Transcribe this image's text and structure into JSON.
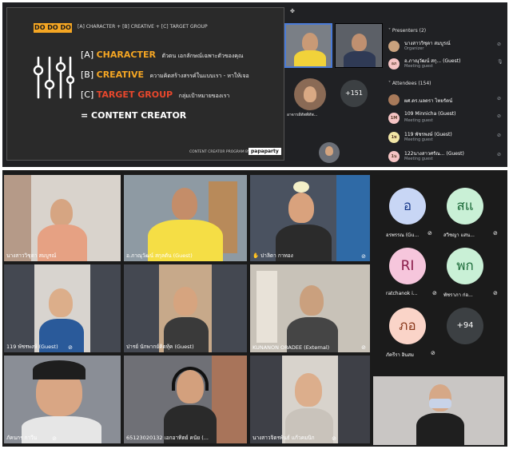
{
  "slide": {
    "logo": "DO DO DO",
    "header": "[A] CHARACTER + [B] CREATIVE + [C] TARGET GROUP",
    "line_a_key": "[A]",
    "line_a_word": "CHARACTER",
    "line_a_thai": "ตัวตน เอกลักษณ์เฉพาะตัวของคุณ",
    "line_b_key": "[B]",
    "line_b_word": "CREATIVE",
    "line_b_thai": "ความคิดสร้างสรรค์ในแบบเรา - หาให้เจอ",
    "line_c_key": "[C]",
    "line_c_word": "TARGET GROUP",
    "line_c_thai": "กลุ่มเป้าหมายของเรา",
    "formula": "= CONTENT CREATOR",
    "footer": "CONTENT CREATOR PROGRAM BY",
    "footer_logo": "papaparty"
  },
  "top_tiles": {
    "tile4_label": "อาจารย์ทัพพ์ทัพ...",
    "more_count": "+151"
  },
  "panel": {
    "presenters_title": "Presenters (2)",
    "presenters": [
      {
        "name": "นางสาววิชุดา สมบูรณ์",
        "sub": "Organizer",
        "initials": "",
        "color": "#c9a27e"
      },
      {
        "name": "อ.ภาณุวัฒน์ สกุ... (Guest)",
        "sub": "Meeting guest",
        "initials": "อภ",
        "color": "#f6c4c4"
      }
    ],
    "attendees_title": "Attendees (154)",
    "attendees": [
      {
        "name": "ผศ.ดร.นลตรา ไทยรัตน์",
        "sub": "",
        "initials": "",
        "color": "#a87a5a"
      },
      {
        "name": "109 Minnicha (Guest)",
        "sub": "Meeting guest",
        "initials": "1M",
        "color": "#f6c4c4"
      },
      {
        "name": "119 พัชรพงษ์ (Guest)",
        "sub": "Meeting guest",
        "initials": "1พ",
        "color": "#f2e6a6"
      },
      {
        "name": "122นางสาวศรัณ... (Guest)",
        "sub": "Meeting guest",
        "initials": "1น",
        "color": "#f6c4c4"
      }
    ]
  },
  "gallery": {
    "tiles": [
      {
        "label": "นางสาววิชุดา สมบูรณ์"
      },
      {
        "label": "อ.ภาณุวัฒน์ สกุลตัน (Guest)"
      },
      {
        "label": "ปาลิตา กาทอง"
      },
      {
        "label": "119 พัชรพงษ์ (Guest)"
      },
      {
        "label": "ปารย์ นักพากย์คิดทุ้ค (Guest)"
      },
      {
        "label": "KUNANON ORADEE (External)"
      },
      {
        "label": "ภัคนกร กาวีน"
      },
      {
        "label": "65123020132 เอกอาทิตย์ คนัย (..."
      },
      {
        "label": "นางสาวจิตรพันธ์ แก้วคมนิก"
      },
      {
        "label": ""
      }
    ],
    "avatars": [
      {
        "initials": "อ",
        "name": "อรพรรณ (Gu...",
        "bg": "#c8d6f5",
        "fg": "#1a3a8a"
      },
      {
        "initials": "สแ",
        "name": "สวิชญา แสน...",
        "bg": "#c9f0d6",
        "fg": "#1d6b3a"
      },
      {
        "initials": "RI",
        "name": "ratchanok i...",
        "bg": "#f6c6dc",
        "fg": "#8a1d4a"
      },
      {
        "initials": "พก",
        "name": "พัชราภา ก่อ...",
        "bg": "#c9f0d6",
        "fg": "#1d6b3a"
      },
      {
        "initials": "ภอ",
        "name": "ภัครีรา อินสม",
        "bg": "#fad4c8",
        "fg": "#8a3a1d"
      }
    ],
    "more_count": "+94"
  }
}
